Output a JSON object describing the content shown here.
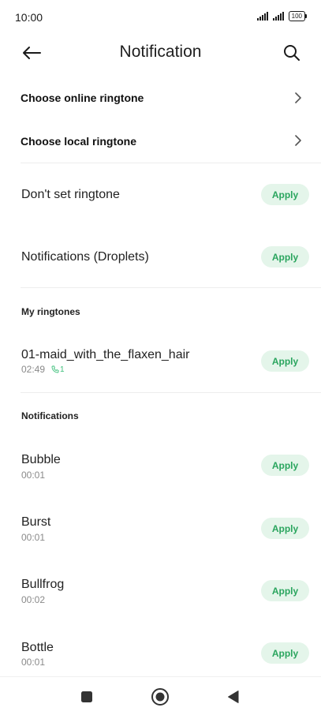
{
  "status_bar": {
    "time": "10:00",
    "battery": "100",
    "signal_icons": [
      "signal-icon",
      "signal-icon"
    ]
  },
  "header": {
    "title": "Notification",
    "back_icon": "arrow-left-icon",
    "search_icon": "search-icon"
  },
  "nav_rows": [
    {
      "label": "Choose online ringtone",
      "icon": "chevron-right-icon"
    },
    {
      "label": "Choose local ringtone",
      "icon": "chevron-right-icon"
    }
  ],
  "options": [
    {
      "label": "Don't set ringtone",
      "button": "Apply"
    },
    {
      "label": "Notifications (Droplets)",
      "button": "Apply"
    }
  ],
  "my_ringtones": {
    "header": "My ringtones",
    "items": [
      {
        "name": "01-maid_with_the_flaxen_hair",
        "duration": "02:49",
        "call_badge": "1",
        "badge_icon": "phone-icon",
        "button": "Apply"
      }
    ]
  },
  "notifications": {
    "header": "Notifications",
    "items": [
      {
        "name": "Bubble",
        "duration": "00:01",
        "button": "Apply"
      },
      {
        "name": "Burst",
        "duration": "00:01",
        "button": "Apply"
      },
      {
        "name": "Bullfrog",
        "duration": "00:02",
        "button": "Apply"
      },
      {
        "name": "Bottle",
        "duration": "00:01",
        "button": "Apply"
      }
    ]
  },
  "bottom_nav": {
    "icons": [
      "recent-apps-icon",
      "home-icon",
      "back-icon"
    ]
  },
  "colors": {
    "accent": "#2aa55e",
    "apply_bg": "#e4f5ea",
    "divider": "#ededed"
  }
}
